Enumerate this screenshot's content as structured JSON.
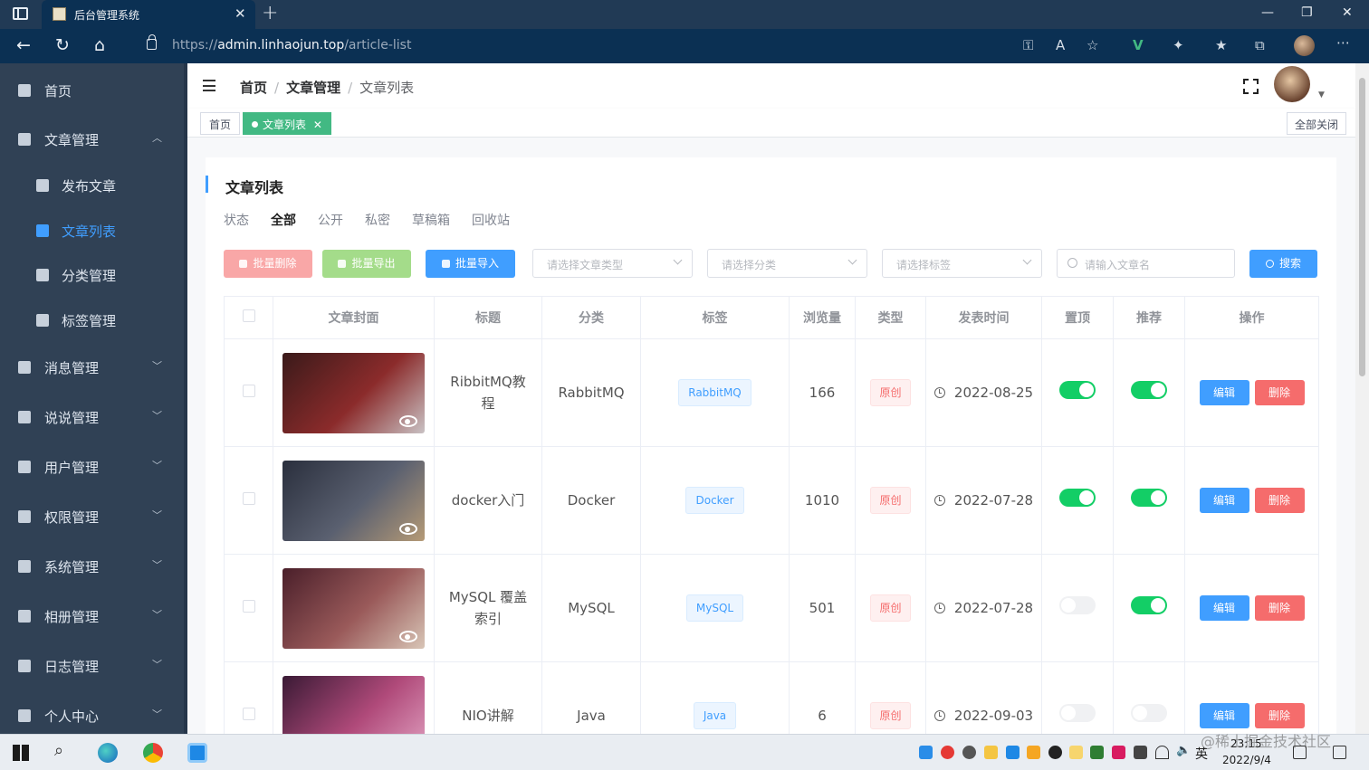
{
  "browser": {
    "tab_title": "后台管理系统",
    "url_prefix": "https://",
    "url_host": "admin.linhaojun.top",
    "url_path": "/article-list"
  },
  "sidebar": {
    "items": [
      {
        "label": "首页",
        "icon": "home-icon"
      },
      {
        "label": "文章管理",
        "icon": "document-icon",
        "expanded": true
      },
      {
        "label": "发布文章",
        "icon": "edit-icon",
        "sub": true
      },
      {
        "label": "文章列表",
        "icon": "list-icon",
        "sub": true,
        "active": true
      },
      {
        "label": "分类管理",
        "icon": "grid-icon",
        "sub": true
      },
      {
        "label": "标签管理",
        "icon": "tag-icon",
        "sub": true
      },
      {
        "label": "消息管理",
        "icon": "mail-icon"
      },
      {
        "label": "说说管理",
        "icon": "chat-icon"
      },
      {
        "label": "用户管理",
        "icon": "user-icon"
      },
      {
        "label": "权限管理",
        "icon": "shield-icon"
      },
      {
        "label": "系统管理",
        "icon": "gear-icon"
      },
      {
        "label": "相册管理",
        "icon": "picture-icon"
      },
      {
        "label": "日志管理",
        "icon": "log-icon"
      },
      {
        "label": "个人中心",
        "icon": "person-icon"
      }
    ]
  },
  "breadcrumb": {
    "home": "首页",
    "section": "文章管理",
    "current": "文章列表"
  },
  "tagsview": {
    "home": "首页",
    "current": "文章列表",
    "close_all": "全部关闭"
  },
  "card": {
    "title": "文章列表",
    "status_label": "状态",
    "status_tabs": [
      "全部",
      "公开",
      "私密",
      "草稿箱",
      "回收站"
    ]
  },
  "toolbar": {
    "batch_delete": "批量删除",
    "batch_export": "批量导出",
    "batch_import": "批量导入",
    "type_placeholder": "请选择文章类型",
    "category_placeholder": "请选择分类",
    "tag_placeholder": "请选择标签",
    "name_placeholder": "请输入文章名",
    "search": "搜索"
  },
  "table": {
    "headers": [
      "文章封面",
      "标题",
      "分类",
      "标签",
      "浏览量",
      "类型",
      "发表时间",
      "置顶",
      "推荐",
      "操作"
    ],
    "edit_label": "编辑",
    "delete_label": "删除",
    "rows": [
      {
        "title": "RibbitMQ教程",
        "category": "RabbitMQ",
        "tag": "RabbitMQ",
        "views": "166",
        "type": "原创",
        "date": "2022-08-25",
        "top": true,
        "recommend": true,
        "cover": [
          "#3a1a1a",
          "#8b2b2b",
          "#c9c2c4"
        ]
      },
      {
        "title": "docker入门",
        "category": "Docker",
        "tag": "Docker",
        "views": "1010",
        "type": "原创",
        "date": "2022-07-28",
        "top": true,
        "recommend": true,
        "cover": [
          "#2a2f3d",
          "#5a6070",
          "#b59a76"
        ]
      },
      {
        "title": "MySQL 覆盖索引",
        "category": "MySQL",
        "tag": "MySQL",
        "views": "501",
        "type": "原创",
        "date": "2022-07-28",
        "top": false,
        "recommend": true,
        "cover": [
          "#4a1f2a",
          "#9a5a5a",
          "#d8c5b6"
        ]
      },
      {
        "title": "NIO讲解",
        "category": "Java",
        "tag": "Java",
        "views": "6",
        "type": "原创",
        "date": "2022-09-03",
        "top": false,
        "recommend": false,
        "cover": [
          "#3a1a35",
          "#b04a7a",
          "#e0a0c0"
        ]
      }
    ]
  },
  "taskbar": {
    "time": "23:15",
    "date": "2022/9/4",
    "ime": "英",
    "watermark": "@稀土掘金技术社区"
  },
  "colors": {
    "sidebar": "#304155",
    "accent": "#409eff",
    "success": "#13ce66",
    "danger": "#f56c6c",
    "tag_green": "#42b983"
  }
}
